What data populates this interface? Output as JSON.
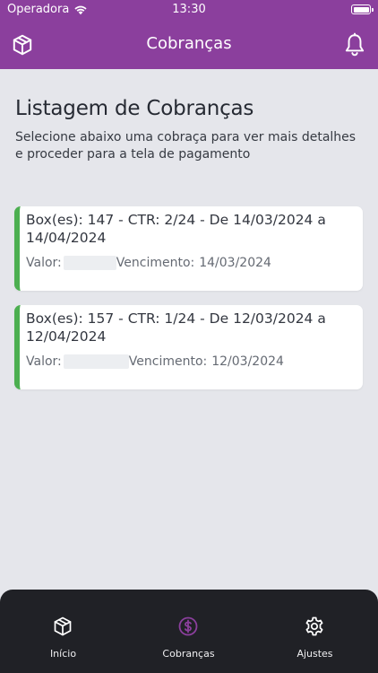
{
  "status_bar": {
    "carrier": "Operadora",
    "time": "13:30"
  },
  "app_bar": {
    "title": "Cobranças",
    "left_icon": "package-icon",
    "right_icon": "bell-icon"
  },
  "page": {
    "title": "Listagem de Cobranças",
    "subtitle": "Selecione abaixo uma cobraça para ver mais detalhes e proceder para a tela de pagamento"
  },
  "charges": [
    {
      "title": "Box(es): 147 - CTR: 2/24 - De 14/03/2024 a 14/04/2024",
      "value_label": "Valor:",
      "due_label": "Vencimento:",
      "due_date": "14/03/2024"
    },
    {
      "title": "Box(es): 157 - CTR: 1/24 - De 12/03/2024 a 12/04/2024",
      "value_label": "Valor:",
      "due_label": "Vencimento:",
      "due_date": "12/03/2024"
    }
  ],
  "tab_bar": {
    "tabs": [
      {
        "label": "Início",
        "icon": "package-icon",
        "active": false
      },
      {
        "label": "Cobranças",
        "icon": "dollar-circle-icon",
        "active": true
      },
      {
        "label": "Ajustes",
        "icon": "gear-icon",
        "active": false
      }
    ]
  },
  "colors": {
    "header": "#8b3f9d",
    "accent_active": "#8b3f9d",
    "card_status": "#4caf50",
    "background": "#e5e6eb",
    "tab_bar": "#202126"
  }
}
